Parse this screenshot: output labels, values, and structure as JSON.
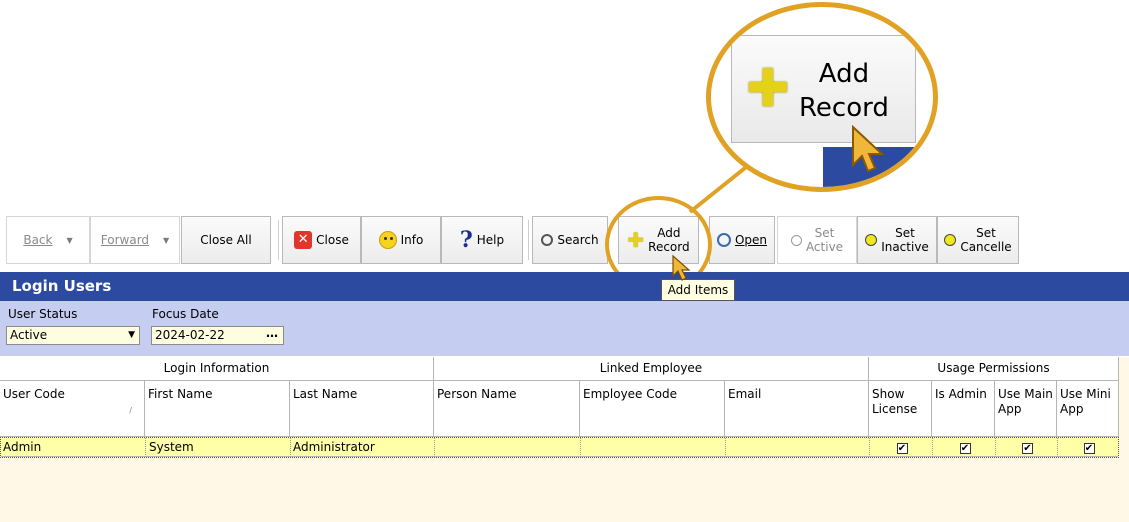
{
  "toolbar": {
    "back": "Back",
    "forward": "Forward",
    "close_all": "Close All",
    "close": "Close",
    "info": "Info",
    "help": "Help",
    "search": "Search",
    "add_record_line1": "Add",
    "add_record_line2": "Record",
    "open": "Open",
    "set_active_line1": "Set",
    "set_active_line2": "Active",
    "set_inactive_line1": "Set",
    "set_inactive_line2": "Inactive",
    "set_cancelled_line1": "Set",
    "set_cancelled_line2": "Cancelle"
  },
  "tooltip": "Add Items",
  "page_title": "Login Users",
  "filters": {
    "user_status_label": "User Status",
    "user_status_value": "Active",
    "focus_date_label": "Focus Date",
    "focus_date_value": "2024-02-22"
  },
  "grid": {
    "groups": [
      "Login Information",
      "Linked Employee",
      "Usage Permissions"
    ],
    "columns": [
      "User Code",
      "First Name",
      "Last Name",
      "Person Name",
      "Employee Code",
      "Email",
      "Show License",
      "Is Admin",
      "Use Main App",
      "Use Mini App"
    ],
    "rows": [
      {
        "user_code": "Admin",
        "first_name": "System",
        "last_name": "Administrator",
        "person_name": "",
        "employee_code": "",
        "email": "",
        "show_license": true,
        "is_admin": true,
        "use_main_app": true,
        "use_mini_app": true
      }
    ]
  },
  "colors": {
    "title_bar": "#2c4aa0",
    "filter_bar": "#c5cdf0",
    "selected_row": "#ffffa8",
    "callout": "#e1a123"
  },
  "icons": [
    "close-icon",
    "info-icon",
    "help-icon",
    "search-icon",
    "add-icon",
    "open-icon",
    "status-circle-icon"
  ],
  "zoom_callout": {
    "label_line1": "Add",
    "label_line2": "Record"
  }
}
